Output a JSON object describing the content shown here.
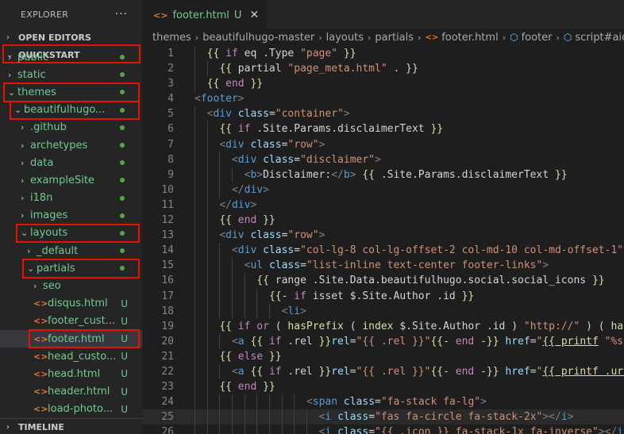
{
  "colors": {
    "untracked": "#73c991",
    "modified_dot": "#57a64a",
    "highlight_box": "#e51400",
    "folder_text": "#73c991"
  },
  "sidebar": {
    "title": "EXPLORER",
    "more_icon": "···",
    "open_editors": "OPEN EDITORS",
    "quickstart": "QUICKSTART",
    "timeline": "TIMELINE",
    "tree": [
      {
        "id": "public",
        "label": "public",
        "depth": 1,
        "type": "folder",
        "expanded": false,
        "status": "dot"
      },
      {
        "id": "static",
        "label": "static",
        "depth": 1,
        "type": "folder",
        "expanded": false,
        "status": "dot"
      },
      {
        "id": "themes",
        "label": "themes",
        "depth": 1,
        "type": "folder",
        "expanded": true,
        "status": "dot",
        "boxed": true
      },
      {
        "id": "beautifulhugo",
        "label": "beautifulhugo...",
        "depth": 2,
        "type": "folder",
        "expanded": true,
        "status": "dot",
        "boxed": true
      },
      {
        "id": "github",
        "label": ".github",
        "depth": 3,
        "type": "folder",
        "expanded": false,
        "status": "dot"
      },
      {
        "id": "archetypes",
        "label": "archetypes",
        "depth": 3,
        "type": "folder",
        "expanded": false,
        "status": "dot"
      },
      {
        "id": "data",
        "label": "data",
        "depth": 3,
        "type": "folder",
        "expanded": false,
        "status": "dot"
      },
      {
        "id": "exampleSite",
        "label": "exampleSite",
        "depth": 3,
        "type": "folder",
        "expanded": false,
        "status": "dot"
      },
      {
        "id": "i18n",
        "label": "i18n",
        "depth": 3,
        "type": "folder",
        "expanded": false,
        "status": "dot"
      },
      {
        "id": "images",
        "label": "images",
        "depth": 3,
        "type": "folder",
        "expanded": false,
        "status": "dot"
      },
      {
        "id": "layouts",
        "label": "layouts",
        "depth": 3,
        "type": "folder",
        "expanded": true,
        "status": "dot",
        "boxed": true
      },
      {
        "id": "default",
        "label": "_default",
        "depth": 4,
        "type": "folder",
        "expanded": false,
        "status": "dot"
      },
      {
        "id": "partials",
        "label": "partials",
        "depth": 4,
        "type": "folder",
        "expanded": true,
        "status": "dot",
        "boxed": true
      },
      {
        "id": "seo",
        "label": "seo",
        "depth": 5,
        "type": "folder",
        "expanded": false,
        "status": "none"
      },
      {
        "id": "disqus",
        "label": "disqus.html",
        "depth": 5,
        "type": "file",
        "status": "U"
      },
      {
        "id": "footer_custom",
        "label": "footer_cust...",
        "depth": 5,
        "type": "file",
        "status": "U"
      },
      {
        "id": "footer",
        "label": "footer.html",
        "depth": 5,
        "type": "file",
        "status": "U",
        "selected": true,
        "boxed": true
      },
      {
        "id": "head_custom",
        "label": "head_custo...",
        "depth": 5,
        "type": "file",
        "status": "U"
      },
      {
        "id": "head",
        "label": "head.html",
        "depth": 5,
        "type": "file",
        "status": "U"
      },
      {
        "id": "header",
        "label": "header.html",
        "depth": 5,
        "type": "file",
        "status": "U"
      },
      {
        "id": "load_photo",
        "label": "load-photo...",
        "depth": 5,
        "type": "file",
        "status": "U"
      }
    ]
  },
  "editor": {
    "tab": {
      "filename": "footer.html",
      "status": "U",
      "close": "✕",
      "icon": "<>"
    },
    "breadcrumb": {
      "crumbs": [
        "themes",
        "beautifulhugo-master",
        "layouts",
        "partials",
        "footer.html",
        "footer",
        "script#aioa-adap"
      ],
      "file_icon": "<>",
      "element_icon": "⬡"
    },
    "code": {
      "current_line": 25,
      "lines": [
        {
          "n": "1",
          "indent": 1,
          "tokens": [
            [
              "br",
              "{{ "
            ],
            [
              "kw",
              "if"
            ],
            [
              "tx",
              " eq .Type "
            ],
            [
              "st",
              "\"page\""
            ],
            [
              "br",
              " }}"
            ]
          ]
        },
        {
          "n": "2",
          "indent": 2,
          "tokens": [
            [
              "br",
              "{{ "
            ],
            [
              "tx",
              "partial "
            ],
            [
              "st",
              "\"page_meta.html\""
            ],
            [
              "tx",
              " . "
            ],
            [
              "br",
              "}}"
            ]
          ]
        },
        {
          "n": "3",
          "indent": 1,
          "tokens": [
            [
              "br",
              "{{ "
            ],
            [
              "kw",
              "end"
            ],
            [
              "br",
              " }}"
            ]
          ]
        },
        {
          "n": "4",
          "indent": 0,
          "tokens": [
            [
              "pn",
              "<"
            ],
            [
              "tag",
              "footer"
            ],
            [
              "pn",
              ">"
            ]
          ]
        },
        {
          "n": "5",
          "indent": 1,
          "tokens": [
            [
              "pn",
              "<"
            ],
            [
              "tag",
              "div"
            ],
            [
              "tx",
              " "
            ],
            [
              "at",
              "class"
            ],
            [
              "op",
              "="
            ],
            [
              "st",
              "\"container\""
            ],
            [
              "pn",
              ">"
            ]
          ]
        },
        {
          "n": "6",
          "indent": 2,
          "tokens": [
            [
              "br",
              "{{ "
            ],
            [
              "kw",
              "if"
            ],
            [
              "tx",
              " .Site.Params.disclaimerText "
            ],
            [
              "br",
              "}}"
            ]
          ]
        },
        {
          "n": "7",
          "indent": 2,
          "tokens": [
            [
              "pn",
              "<"
            ],
            [
              "tag",
              "div"
            ],
            [
              "tx",
              " "
            ],
            [
              "at",
              "class"
            ],
            [
              "op",
              "="
            ],
            [
              "st",
              "\"row\""
            ],
            [
              "pn",
              ">"
            ]
          ]
        },
        {
          "n": "8",
          "indent": 3,
          "tokens": [
            [
              "pn",
              "<"
            ],
            [
              "tag",
              "div"
            ],
            [
              "tx",
              " "
            ],
            [
              "at",
              "class"
            ],
            [
              "op",
              "="
            ],
            [
              "st",
              "\"disclaimer\""
            ],
            [
              "pn",
              ">"
            ]
          ]
        },
        {
          "n": "9",
          "indent": 4,
          "tokens": [
            [
              "pn",
              "<"
            ],
            [
              "tag",
              "b"
            ],
            [
              "pn",
              ">"
            ],
            [
              "tx",
              "Disclaimer:"
            ],
            [
              "pn",
              "</"
            ],
            [
              "tag",
              "b"
            ],
            [
              "pn",
              ">"
            ],
            [
              "tx",
              " "
            ],
            [
              "br",
              "{{"
            ],
            [
              "tx",
              " .Site.Params.disclaimerText "
            ],
            [
              "br",
              "}}"
            ]
          ]
        },
        {
          "n": "10",
          "indent": 3,
          "tokens": [
            [
              "pn",
              "</"
            ],
            [
              "tag",
              "div"
            ],
            [
              "pn",
              ">"
            ]
          ]
        },
        {
          "n": "11",
          "indent": 2,
          "tokens": [
            [
              "pn",
              "</"
            ],
            [
              "tag",
              "div"
            ],
            [
              "pn",
              ">"
            ]
          ]
        },
        {
          "n": "12",
          "indent": 2,
          "tokens": [
            [
              "br",
              "{{ "
            ],
            [
              "kw",
              "end"
            ],
            [
              "br",
              " }}"
            ]
          ]
        },
        {
          "n": "13",
          "indent": 2,
          "tokens": [
            [
              "pn",
              "<"
            ],
            [
              "tag",
              "div"
            ],
            [
              "tx",
              " "
            ],
            [
              "at",
              "class"
            ],
            [
              "op",
              "="
            ],
            [
              "st",
              "\"row\""
            ],
            [
              "pn",
              ">"
            ]
          ]
        },
        {
          "n": "14",
          "indent": 3,
          "tokens": [
            [
              "pn",
              "<"
            ],
            [
              "tag",
              "div"
            ],
            [
              "tx",
              " "
            ],
            [
              "at",
              "class"
            ],
            [
              "op",
              "="
            ],
            [
              "st",
              "\"col-lg-8 col-lg-offset-2 col-md-10 col-md-offset-1\""
            ],
            [
              "pn",
              ">"
            ]
          ]
        },
        {
          "n": "15",
          "indent": 4,
          "tokens": [
            [
              "pn",
              "<"
            ],
            [
              "tag",
              "ul"
            ],
            [
              "tx",
              " "
            ],
            [
              "at",
              "class"
            ],
            [
              "op",
              "="
            ],
            [
              "st",
              "\"list-inline text-center footer-links\""
            ],
            [
              "pn",
              ">"
            ]
          ]
        },
        {
          "n": "16",
          "indent": 5,
          "tokens": [
            [
              "br",
              "{{ "
            ],
            [
              "tx",
              "range .Site.Data.beautifulhugo.social.social_icons "
            ],
            [
              "br",
              "}}"
            ]
          ]
        },
        {
          "n": "17",
          "indent": 6,
          "tokens": [
            [
              "br",
              "{{- "
            ],
            [
              "kw",
              "if"
            ],
            [
              "tx",
              " isset $.Site.Author .id "
            ],
            [
              "br",
              "}}"
            ]
          ]
        },
        {
          "n": "18",
          "indent": 7,
          "tokens": [
            [
              "pn",
              "<"
            ],
            [
              "tag",
              "li"
            ],
            [
              "pn",
              ">"
            ]
          ]
        },
        {
          "n": "19",
          "indent": 2,
          "tokens": [
            [
              "br",
              "{{ "
            ],
            [
              "kw",
              "if"
            ],
            [
              "tx",
              " "
            ],
            [
              "kw",
              "or"
            ],
            [
              "tx",
              " ( "
            ],
            [
              "fn",
              "hasPrefix"
            ],
            [
              "tx",
              " ( "
            ],
            [
              "fn",
              "index"
            ],
            [
              "tx",
              " $.Site.Author .id ) "
            ],
            [
              "st",
              "\"http://\""
            ],
            [
              "tx",
              " ) ( "
            ],
            [
              "fn",
              "has"
            ]
          ]
        },
        {
          "n": "20",
          "indent": 3,
          "tokens": [
            [
              "pn",
              "<"
            ],
            [
              "tag",
              "a"
            ],
            [
              "tx",
              " "
            ],
            [
              "br",
              "{{"
            ],
            [
              "tx",
              " "
            ],
            [
              "kw",
              "if"
            ],
            [
              "tx",
              " .rel "
            ],
            [
              "br",
              "}}"
            ],
            [
              "at",
              "rel"
            ],
            [
              "op",
              "="
            ],
            [
              "st",
              "\"{{ .rel }}\""
            ],
            [
              "br",
              "{{- "
            ],
            [
              "kw",
              "end"
            ],
            [
              "br",
              " -}}"
            ],
            [
              "tx",
              " "
            ],
            [
              "at",
              "href"
            ],
            [
              "op",
              "="
            ],
            [
              "st",
              "\""
            ],
            [
              "ul",
              "{{ printf"
            ],
            [
              "st",
              " \"%s\""
            ]
          ]
        },
        {
          "n": "21",
          "indent": 2,
          "tokens": [
            [
              "br",
              "{{ "
            ],
            [
              "kw",
              "else"
            ],
            [
              "br",
              " }}"
            ]
          ]
        },
        {
          "n": "22",
          "indent": 3,
          "tokens": [
            [
              "pn",
              "<"
            ],
            [
              "tag",
              "a"
            ],
            [
              "tx",
              " "
            ],
            [
              "br",
              "{{"
            ],
            [
              "tx",
              " "
            ],
            [
              "kw",
              "if"
            ],
            [
              "tx",
              " .rel "
            ],
            [
              "br",
              "}}"
            ],
            [
              "at",
              "rel"
            ],
            [
              "op",
              "="
            ],
            [
              "st",
              "\"{{ .rel }}\""
            ],
            [
              "br",
              "{{- "
            ],
            [
              "kw",
              "end"
            ],
            [
              "br",
              " -}}"
            ],
            [
              "tx",
              " "
            ],
            [
              "at",
              "href"
            ],
            [
              "op",
              "="
            ],
            [
              "st",
              "\""
            ],
            [
              "ul",
              "{{ printf .url"
            ]
          ]
        },
        {
          "n": "23",
          "indent": 2,
          "tokens": [
            [
              "br",
              "{{ "
            ],
            [
              "kw",
              "end"
            ],
            [
              "br",
              " }}"
            ]
          ]
        },
        {
          "n": "24",
          "indent": 9,
          "tokens": [
            [
              "pn",
              "<"
            ],
            [
              "tag",
              "span"
            ],
            [
              "tx",
              " "
            ],
            [
              "at",
              "class"
            ],
            [
              "op",
              "="
            ],
            [
              "st",
              "\"fa-stack fa-lg\""
            ],
            [
              "pn",
              ">"
            ]
          ]
        },
        {
          "n": "25",
          "indent": 10,
          "tokens": [
            [
              "pn",
              "<"
            ],
            [
              "tag",
              "i"
            ],
            [
              "tx",
              " "
            ],
            [
              "at",
              "class"
            ],
            [
              "op",
              "="
            ],
            [
              "st",
              "\"fas fa-circle fa-stack-2x\""
            ],
            [
              "pn",
              "></"
            ],
            [
              "tag",
              "i"
            ],
            [
              "pn",
              ">"
            ]
          ]
        },
        {
          "n": "26",
          "indent": 10,
          "tokens": [
            [
              "pn",
              "<"
            ],
            [
              "tag",
              "i"
            ],
            [
              "tx",
              " "
            ],
            [
              "at",
              "class"
            ],
            [
              "op",
              "="
            ],
            [
              "st",
              "\"{{ .icon }} fa-stack-1x fa-inverse\""
            ],
            [
              "pn",
              "></"
            ],
            [
              "tag",
              "i"
            ],
            [
              "pn",
              ">"
            ]
          ]
        }
      ]
    }
  }
}
